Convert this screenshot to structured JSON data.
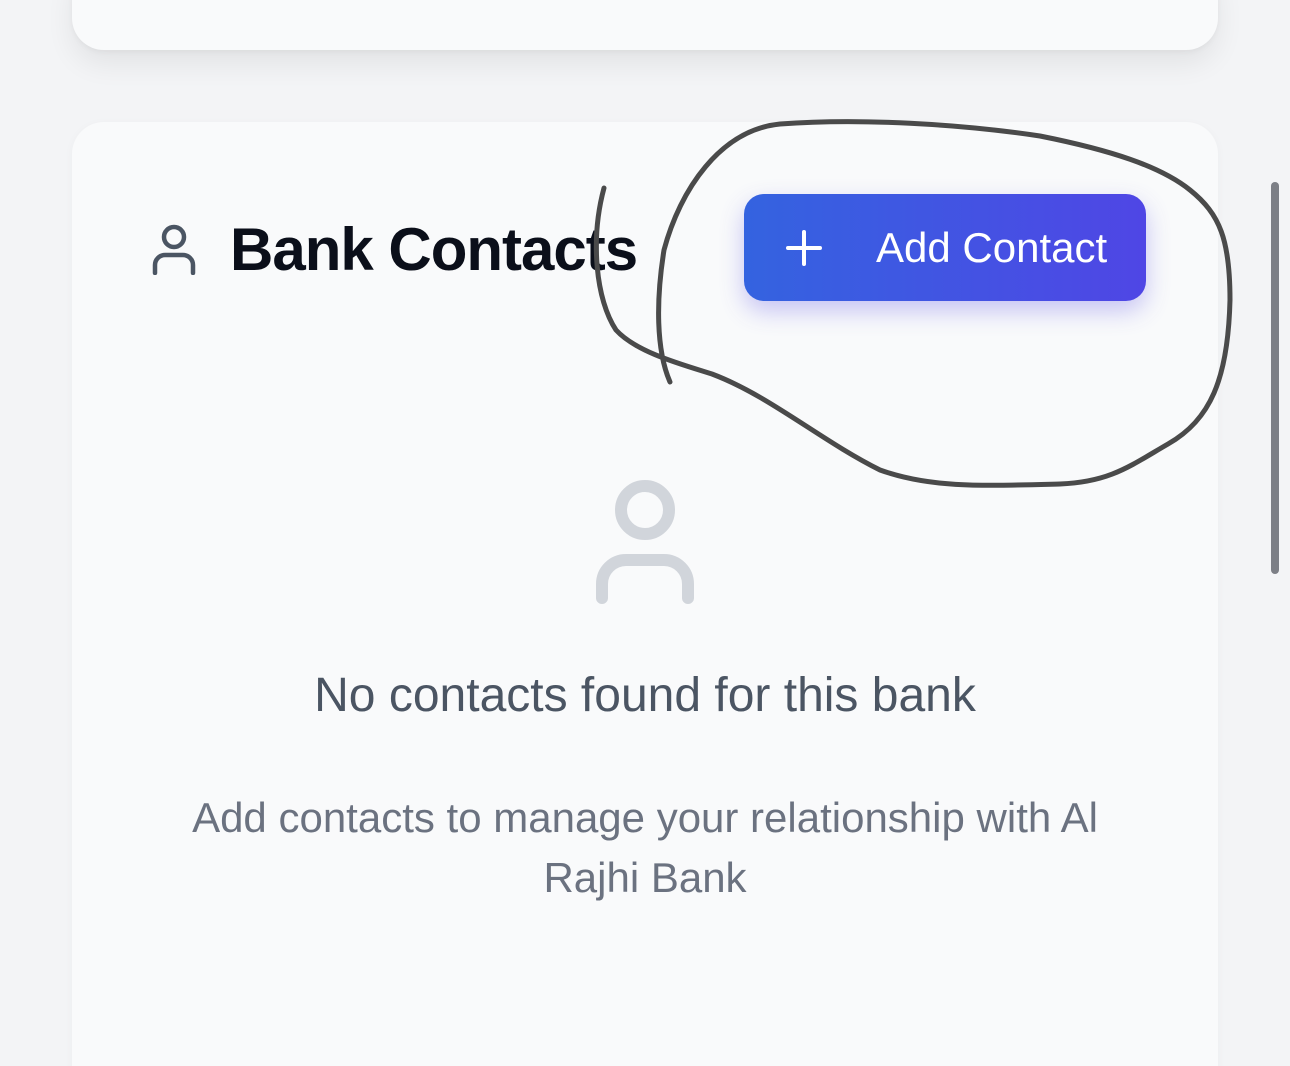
{
  "contacts_section": {
    "title": "Bank Contacts",
    "add_button_label": "Add Contact",
    "empty_state": {
      "title": "No contacts found for this bank",
      "subtitle": "Add contacts to manage your relationship with Al Rajhi Bank"
    }
  },
  "icons": {
    "header": "user-icon",
    "add": "plus-icon",
    "empty": "user-icon"
  },
  "colors": {
    "button_gradient_start": "#3463e0",
    "button_gradient_end": "#4f46e5",
    "title_text": "#0b0f1a",
    "empty_title_text": "#4b5563",
    "empty_subtitle_text": "#6b7280",
    "empty_icon": "#d1d5db",
    "annotation_ink": "#4a4a4a"
  }
}
